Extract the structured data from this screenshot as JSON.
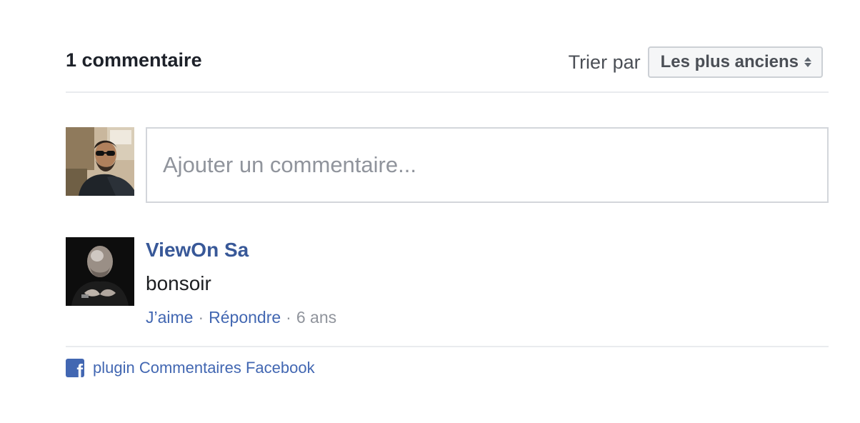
{
  "header": {
    "comment_count_label": "1 commentaire",
    "sort_label": "Trier par",
    "sort_selected": "Les plus anciens"
  },
  "composer": {
    "placeholder": "Ajouter un commentaire...",
    "value": ""
  },
  "comments": [
    {
      "author": "ViewOn Sa",
      "body": "bonsoir",
      "actions": {
        "like": "J’aime",
        "separator": "·",
        "reply": "Répondre",
        "time": "6 ans"
      }
    }
  ],
  "footer": {
    "plugin_text": "plugin Commentaires Facebook",
    "icon": "facebook-icon"
  },
  "colors": {
    "link_blue": "#4267b2",
    "author_blue": "#385898",
    "muted_gray": "#90949c",
    "divider": "#e9ebee"
  }
}
